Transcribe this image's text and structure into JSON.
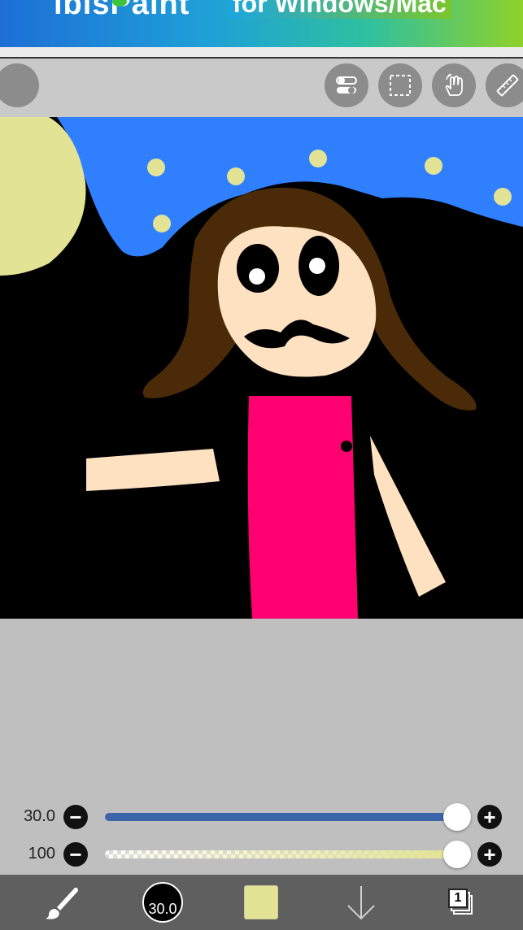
{
  "banner": {
    "logo_text": "ibisPaint",
    "slogan": "for Windows/Mac"
  },
  "toolbar": {
    "left_button": "menu-circle",
    "right_buttons": [
      "toggle-icon",
      "selection-icon",
      "hand-icon",
      "ruler-icon"
    ]
  },
  "sliders": {
    "brush_size": {
      "value": "30.0",
      "level": 1.0,
      "minus": "−",
      "plus": "+"
    },
    "opacity": {
      "value": "100",
      "level": 1.0,
      "minus": "−",
      "plus": "+"
    }
  },
  "bottom_bar": {
    "tool": "brush-icon",
    "brush_size_label": "30.0",
    "current_color": "#e2e395",
    "action": "down-arrow-icon",
    "layers_count": "1"
  },
  "colors": {
    "sky": "#2f7fff",
    "ground": "#000000",
    "moon": "#e2e395",
    "hair": "#4a2a08",
    "skin": "#fde1c0",
    "shirt": "#ff0070",
    "accent_track": "#3c65aa",
    "panel_bg": "#bfbfbf"
  }
}
